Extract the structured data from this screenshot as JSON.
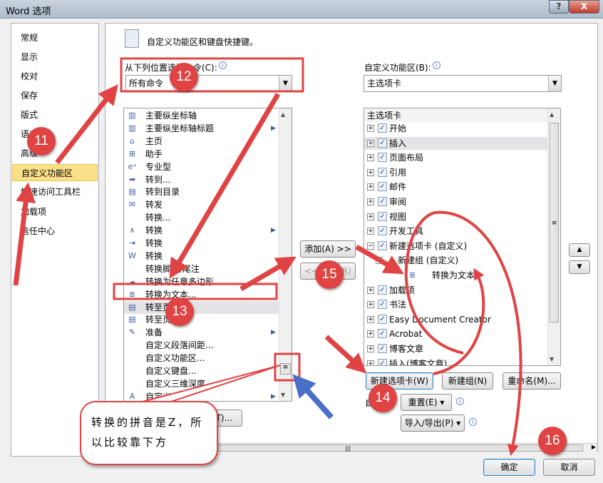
{
  "window": {
    "title": "Word 选项",
    "help": "?",
    "close": "X"
  },
  "nav": {
    "items": [
      "常规",
      "显示",
      "校对",
      "保存",
      "版式",
      "语言",
      "高级",
      "自定义功能区",
      "快速访问工具栏",
      "加载项",
      "信任中心"
    ],
    "selected": "自定义功能区"
  },
  "header": {
    "text": "自定义功能区和键盘快捷键。"
  },
  "left": {
    "label": "从下列位置选择命令(C):",
    "dropdown": "所有命令",
    "items": [
      {
        "t": "主要纵坐标轴",
        "i": "▥",
        "s": false
      },
      {
        "t": "主要纵坐标轴标题",
        "i": "▥",
        "s": true
      },
      {
        "t": "主页",
        "i": "⌂",
        "s": false
      },
      {
        "t": "助手",
        "i": "⊞",
        "s": false
      },
      {
        "t": "专业型",
        "i": "eˣ",
        "s": false
      },
      {
        "t": "转到...",
        "i": "➡",
        "s": false
      },
      {
        "t": "转到目录",
        "i": "▤",
        "s": false
      },
      {
        "t": "转发",
        "i": "✉",
        "s": false
      },
      {
        "t": "转换...",
        "i": "",
        "s": false
      },
      {
        "t": "转换",
        "i": "∧",
        "s": true
      },
      {
        "t": "转换",
        "i": "⇥",
        "s": false
      },
      {
        "t": "转换",
        "i": "W",
        "s": false
      },
      {
        "t": "转换脚注/尾注",
        "i": "",
        "s": false
      },
      {
        "t": "转换为任意多边形",
        "i": "☁",
        "s": false
      },
      {
        "t": "转换为文本...",
        "i": "≣",
        "s": false
      },
      {
        "t": "转至页眉",
        "i": "▤",
        "s": false
      },
      {
        "t": "转至页脚",
        "i": "▤",
        "s": false
      },
      {
        "t": "准备",
        "i": "✎",
        "s": true
      },
      {
        "t": "自定义段落间距...",
        "i": "",
        "s": false
      },
      {
        "t": "自定义功能区...",
        "i": "",
        "s": false
      },
      {
        "t": "自定义键盘...",
        "i": "",
        "s": false
      },
      {
        "t": "自定义三维深度",
        "i": "",
        "s": false
      },
      {
        "t": "自定义...",
        "i": "A",
        "s": true
      }
    ],
    "shortcut_btn": "自定义(T)..."
  },
  "mid": {
    "add": "添加(A) >>",
    "remove": "<< 删除(R)"
  },
  "right": {
    "label": "自定义功能区(B):",
    "dropdown": "主选项卡",
    "tree_header": "主选项卡",
    "items": [
      {
        "t": "开始",
        "pm": "+",
        "cb": true,
        "lv": 0
      },
      {
        "t": "插入",
        "pm": "+",
        "cb": true,
        "lv": 0
      },
      {
        "t": "页面布局",
        "pm": "+",
        "cb": true,
        "lv": 0
      },
      {
        "t": "引用",
        "pm": "+",
        "cb": true,
        "lv": 0
      },
      {
        "t": "邮件",
        "pm": "+",
        "cb": true,
        "lv": 0
      },
      {
        "t": "审阅",
        "pm": "+",
        "cb": true,
        "lv": 0
      },
      {
        "t": "视图",
        "pm": "+",
        "cb": true,
        "lv": 0
      },
      {
        "t": "开发工具",
        "pm": "+",
        "cb": true,
        "lv": 0
      },
      {
        "t": "新建选项卡 (自定义)",
        "pm": "−",
        "cb": true,
        "lv": 0
      },
      {
        "t": "新建组 (自定义)",
        "pm": "−",
        "cb": false,
        "lv": 1
      },
      {
        "t": "转换为文本",
        "pm": "",
        "cb": false,
        "lv": 2
      },
      {
        "t": "加载项",
        "pm": "+",
        "cb": true,
        "lv": 0
      },
      {
        "t": "书法",
        "pm": "+",
        "cb": true,
        "lv": 0
      },
      {
        "t": "Easy Document Creator",
        "pm": "+",
        "cb": true,
        "lv": 0
      },
      {
        "t": "Acrobat",
        "pm": "+",
        "cb": true,
        "lv": 0
      },
      {
        "t": "博客文章",
        "pm": "+",
        "cb": true,
        "lv": 0
      },
      {
        "t": "插入(博客文章)",
        "pm": "+",
        "cb": true,
        "lv": 0
      }
    ],
    "new_tab": "新建选项卡(W)",
    "new_group": "新建组(N)",
    "rename": "重命名(M)...",
    "custom_label": "自定义:",
    "reset": "重置(E) ▾",
    "import_export": "导入/导出(P) ▾"
  },
  "footer": {
    "ok": "确定",
    "cancel": "取消"
  },
  "annotations": {
    "steps": [
      "11",
      "12",
      "13",
      "14",
      "15",
      "16"
    ],
    "callout": [
      "转换的拼音是Z，所",
      "以比较靠下方"
    ],
    "color": "#e04343",
    "blue": "#4a6fc8"
  }
}
